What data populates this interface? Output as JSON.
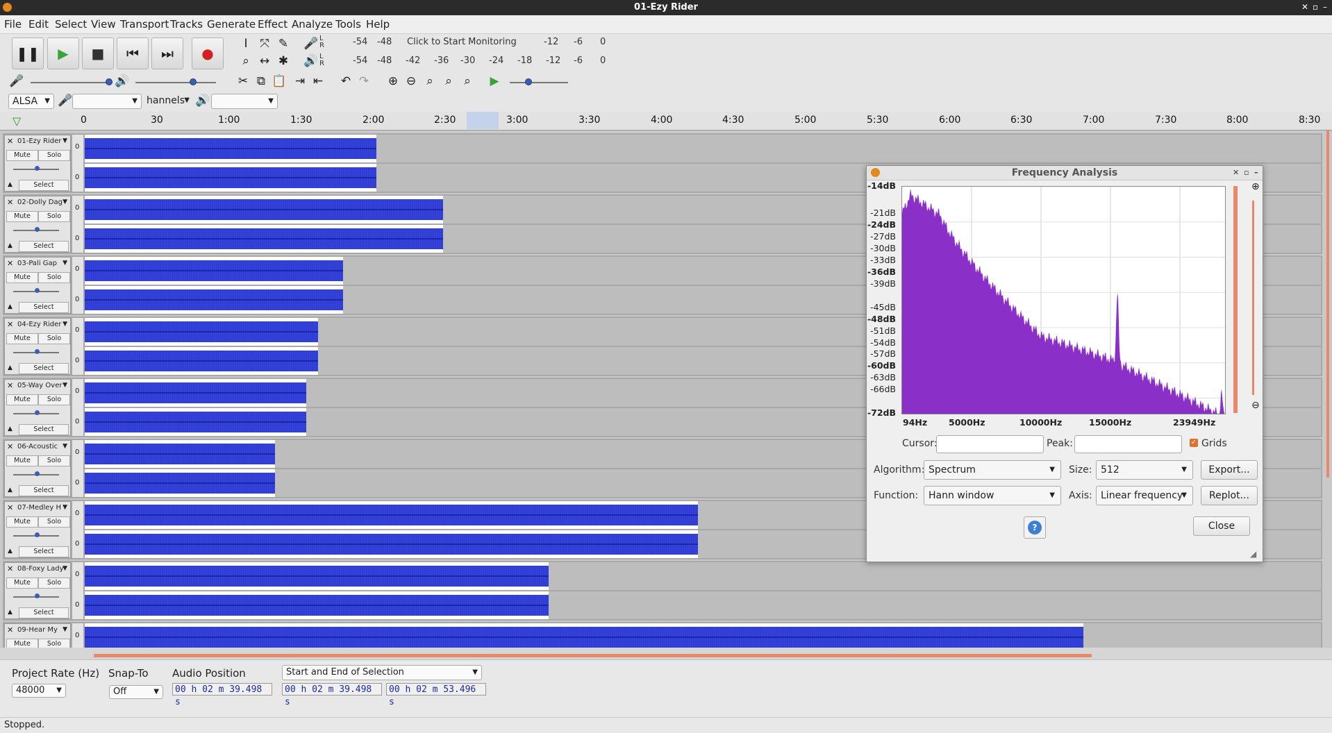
{
  "window": {
    "title": "01-Ezy Rider"
  },
  "menu": [
    "File",
    "Edit",
    "Select",
    "View",
    "Transport",
    "Tracks",
    "Generate",
    "Effect",
    "Analyze",
    "Tools",
    "Help"
  ],
  "meters": {
    "record_scale": [
      "-54",
      "-48",
      "Click to Start Monitoring",
      "-12",
      "-6",
      "0"
    ],
    "play_scale": [
      "-54",
      "-48",
      "-42",
      "-36",
      "-30",
      "-24",
      "-18",
      "-12",
      "-6",
      "0"
    ],
    "lr": [
      "L",
      "R"
    ]
  },
  "device": {
    "host": "ALSA",
    "channels": "hannels"
  },
  "ruler": [
    "0",
    "30",
    "1:00",
    "1:30",
    "2:00",
    "2:30",
    "3:00",
    "3:30",
    "4:00",
    "4:30",
    "5:00",
    "5:30",
    "6:00",
    "6:30",
    "7:00",
    "7:30",
    "8:00",
    "8:30"
  ],
  "track_labels": {
    "mute": "Mute",
    "solo": "Solo",
    "select": "Select",
    "zero": "0"
  },
  "tracks": [
    {
      "name": "01-Ezy Rider",
      "length_fraction": 0.236
    },
    {
      "name": "02-Dolly Dag",
      "length_fraction": 0.29
    },
    {
      "name": "03-Pali Gap",
      "length_fraction": 0.209
    },
    {
      "name": "04-Ezy Rider",
      "length_fraction": 0.189
    },
    {
      "name": "05-Way Over",
      "length_fraction": 0.179
    },
    {
      "name": "06-Acoustic",
      "length_fraction": 0.154
    },
    {
      "name": "07-Medley H",
      "length_fraction": 0.496
    },
    {
      "name": "08-Foxy Lady",
      "length_fraction": 0.375
    },
    {
      "name": "09-Hear My",
      "length_fraction": 0.808
    }
  ],
  "freq_dialog": {
    "title": "Frequency Analysis",
    "y_labels": [
      "-14dB",
      "-21dB",
      "-24dB",
      "-27dB",
      "-30dB",
      "-33dB",
      "-36dB",
      "-39dB",
      "-45dB",
      "-48dB",
      "-51dB",
      "-54dB",
      "-57dB",
      "-60dB",
      "-63dB",
      "-66dB",
      "-72dB"
    ],
    "x_labels": [
      "94Hz",
      "5000Hz",
      "10000Hz",
      "15000Hz",
      "23949Hz"
    ],
    "cursor_label": "Cursor:",
    "peak_label": "Peak:",
    "grids_label": "Grids",
    "grids_checked": true,
    "algorithm_label": "Algorithm:",
    "algorithm_value": "Spectrum",
    "size_label": "Size:",
    "size_value": "512",
    "export_label": "Export...",
    "function_label": "Function:",
    "function_value": "Hann window",
    "axis_label": "Axis:",
    "axis_value": "Linear frequency",
    "replot_label": "Replot...",
    "help_label": "?",
    "close_label": "Close",
    "spectrum_color": "#8b2fc9"
  },
  "bottom": {
    "project_rate_label": "Project Rate (Hz)",
    "project_rate_value": "48000",
    "snap_label": "Snap-To",
    "snap_value": "Off",
    "audio_position_label": "Audio Position",
    "audio_position_value": "00 h 02 m 39.498 s",
    "selection_mode": "Start and End of Selection",
    "sel_start": "00 h 02 m 39.498 s",
    "sel_end": "00 h 02 m 53.496 s"
  },
  "status": "Stopped."
}
